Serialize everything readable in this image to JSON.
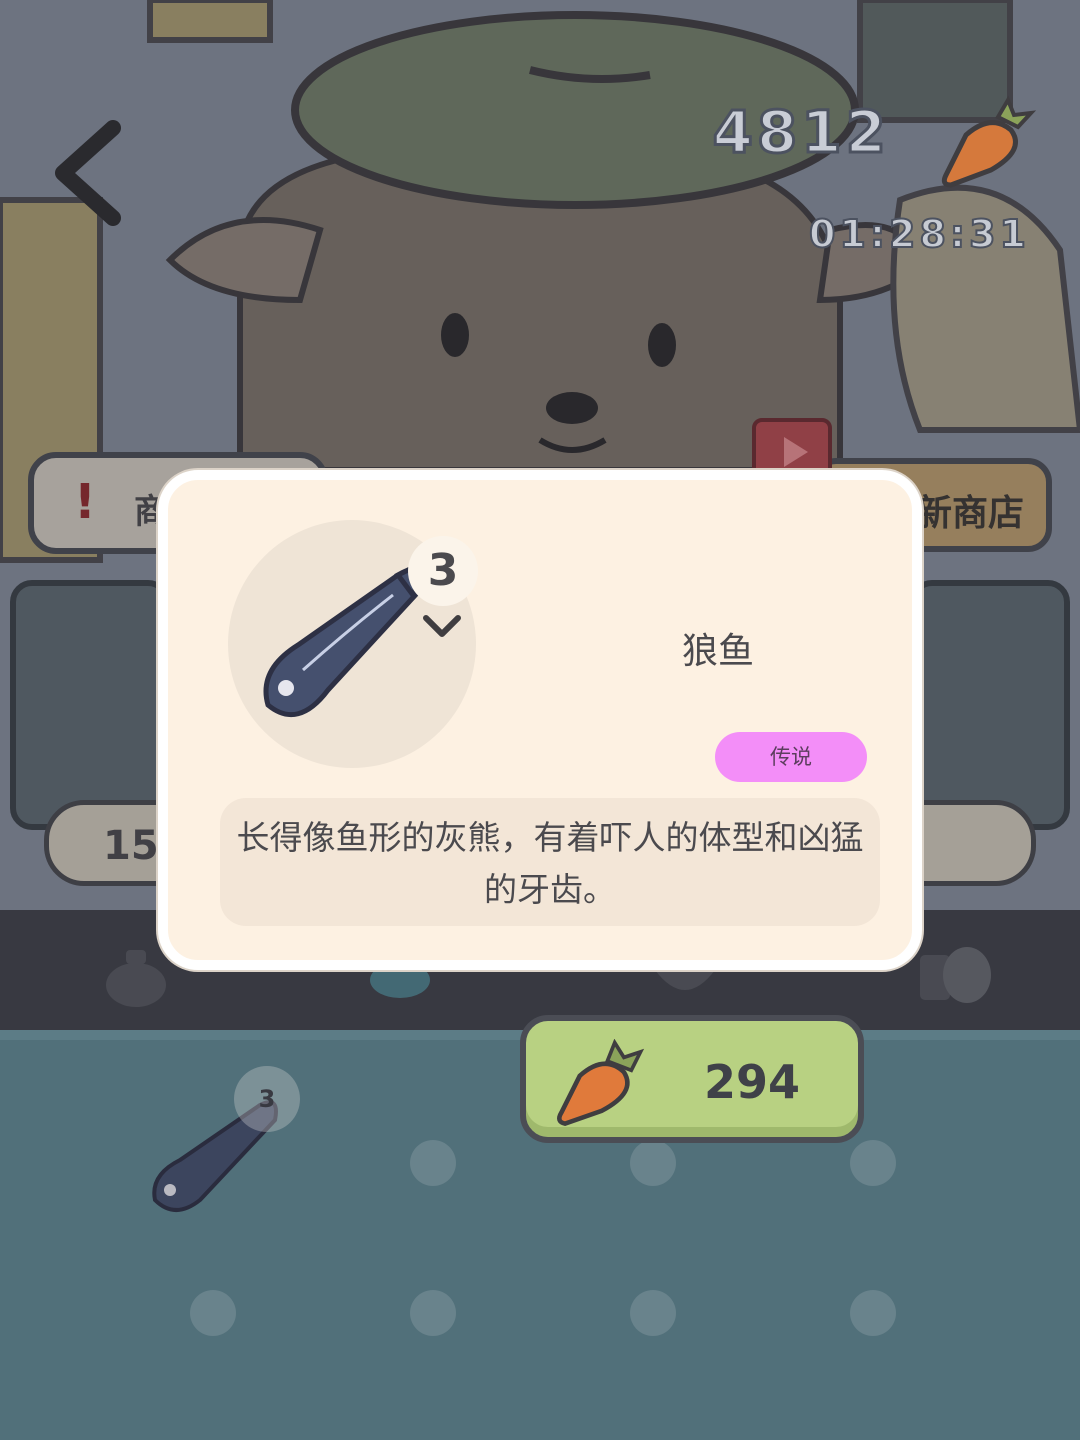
{
  "header": {
    "currency_amount": "4812",
    "timer": "01:28:31"
  },
  "shop": {
    "left_tag_label": "商",
    "left_price": "150",
    "right_tag_label": "新商店"
  },
  "modal": {
    "item_count": "3",
    "item_name": "狼鱼",
    "rarity_label": "传说",
    "rarity_color": "#f38ef8",
    "description": "长得像鱼形的灰熊，有着吓人的体型和凶猛的牙齿。"
  },
  "purchase": {
    "price": "294",
    "button_color": "#b8d182"
  },
  "inventory": {
    "slot_count": "3"
  },
  "icons": [
    "back-icon",
    "carrot-icon",
    "chevron-down-icon",
    "video-ad-icon",
    "fish-icon",
    "bag-icon",
    "bait-icon",
    "bowl-icon",
    "seed-icon"
  ]
}
